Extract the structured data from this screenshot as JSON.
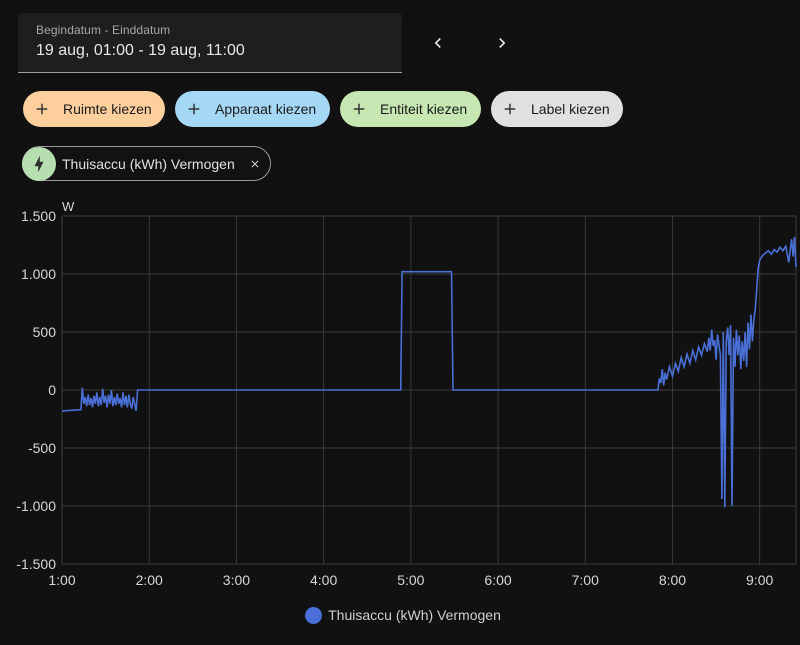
{
  "date_picker": {
    "label": "Begindatum - Einddatum",
    "value": "19 aug, 01:00 - 19 aug, 11:00"
  },
  "nav": {
    "prev_icon": "chevron-left-icon",
    "next_icon": "chevron-right-icon"
  },
  "target_chips": [
    {
      "label": "Ruimte kiezen",
      "color": "#fccf9d"
    },
    {
      "label": "Apparaat kiezen",
      "color": "#a4d8f4"
    },
    {
      "label": "Entiteit kiezen",
      "color": "#c6e6b2"
    },
    {
      "label": "Label kiezen",
      "color": "#e0e0e0"
    }
  ],
  "selected_entity": {
    "label": "Thuisaccu (kWh) Vermogen",
    "icon": "lightning-bolt-icon"
  },
  "chart_data": {
    "type": "line",
    "ylabel": "W",
    "ylim": [
      -1500,
      1500
    ],
    "yticks": [
      "1.500",
      "1.000",
      "500",
      "0",
      "-500",
      "-1.000",
      "-1.500"
    ],
    "ytick_values": [
      1500,
      1000,
      500,
      0,
      -500,
      -1000,
      -1500
    ],
    "xlim": [
      "01:00",
      "09:25"
    ],
    "xticks": [
      "1:00",
      "2:00",
      "3:00",
      "4:00",
      "5:00",
      "6:00",
      "7:00",
      "8:00",
      "9:00"
    ],
    "grid": true,
    "legend_position": "bottom",
    "series": [
      {
        "name": "Thuisaccu (kWh) Vermogen",
        "color": "#4a6fd6",
        "points": [
          [
            "01:00",
            -180
          ],
          [
            "01:13",
            -170
          ],
          [
            "01:14",
            20
          ],
          [
            "01:15",
            -120
          ],
          [
            "01:16",
            -60
          ],
          [
            "01:17",
            -140
          ],
          [
            "01:18",
            -40
          ],
          [
            "01:19",
            -130
          ],
          [
            "01:20",
            -70
          ],
          [
            "01:21",
            -150
          ],
          [
            "01:22",
            -50
          ],
          [
            "01:23",
            -120
          ],
          [
            "01:24",
            -20
          ],
          [
            "01:25",
            -140
          ],
          [
            "01:26",
            -60
          ],
          [
            "01:27",
            -130
          ],
          [
            "01:28",
            10
          ],
          [
            "01:29",
            -110
          ],
          [
            "01:30",
            -50
          ],
          [
            "01:31",
            -150
          ],
          [
            "01:32",
            -40
          ],
          [
            "01:33",
            -120
          ],
          [
            "01:34",
            0
          ],
          [
            "01:35",
            -140
          ],
          [
            "01:36",
            -60
          ],
          [
            "01:37",
            -130
          ],
          [
            "01:38",
            -30
          ],
          [
            "01:39",
            -120
          ],
          [
            "01:40",
            -70
          ],
          [
            "01:41",
            -150
          ],
          [
            "01:42",
            -20
          ],
          [
            "01:43",
            -130
          ],
          [
            "01:44",
            -50
          ],
          [
            "01:45",
            -150
          ],
          [
            "01:46",
            -40
          ],
          [
            "01:47",
            -120
          ],
          [
            "01:48",
            -160
          ],
          [
            "01:49",
            -60
          ],
          [
            "01:51",
            -180
          ],
          [
            "01:52",
            0
          ],
          [
            "04:53",
            0
          ],
          [
            "04:54",
            1020
          ],
          [
            "05:28",
            1020
          ],
          [
            "05:29",
            0
          ],
          [
            "07:50",
            0
          ],
          [
            "07:51",
            100
          ],
          [
            "07:52",
            60
          ],
          [
            "07:53",
            180
          ],
          [
            "07:54",
            40
          ],
          [
            "07:55",
            150
          ],
          [
            "07:56",
            90
          ],
          [
            "07:58",
            200
          ],
          [
            "08:00",
            120
          ],
          [
            "08:02",
            230
          ],
          [
            "08:04",
            160
          ],
          [
            "08:06",
            280
          ],
          [
            "08:08",
            200
          ],
          [
            "08:10",
            310
          ],
          [
            "08:12",
            230
          ],
          [
            "08:14",
            340
          ],
          [
            "08:16",
            260
          ],
          [
            "08:18",
            370
          ],
          [
            "08:20",
            300
          ],
          [
            "08:22",
            400
          ],
          [
            "08:24",
            330
          ],
          [
            "08:25",
            450
          ],
          [
            "08:26",
            340
          ],
          [
            "08:27",
            520
          ],
          [
            "08:28",
            380
          ],
          [
            "08:29",
            430
          ],
          [
            "08:30",
            260
          ],
          [
            "08:31",
            480
          ],
          [
            "08:33",
            300
          ],
          [
            "08:34",
            -940
          ],
          [
            "08:35",
            500
          ],
          [
            "08:36",
            -1010
          ],
          [
            "08:37",
            420
          ],
          [
            "08:38",
            540
          ],
          [
            "08:39",
            300
          ],
          [
            "08:40",
            560
          ],
          [
            "08:41",
            -1000
          ],
          [
            "08:42",
            450
          ],
          [
            "08:43",
            200
          ],
          [
            "08:44",
            520
          ],
          [
            "08:45",
            300
          ],
          [
            "08:46",
            470
          ],
          [
            "08:47",
            180
          ],
          [
            "08:48",
            420
          ],
          [
            "08:49",
            250
          ],
          [
            "08:50",
            500
          ],
          [
            "08:51",
            200
          ],
          [
            "08:52",
            580
          ],
          [
            "08:53",
            350
          ],
          [
            "08:54",
            650
          ],
          [
            "08:55",
            420
          ],
          [
            "08:56",
            600
          ],
          [
            "08:57",
            700
          ],
          [
            "08:58",
            880
          ],
          [
            "08:59",
            1050
          ],
          [
            "09:00",
            1120
          ],
          [
            "09:02",
            1160
          ],
          [
            "09:04",
            1180
          ],
          [
            "09:06",
            1200
          ],
          [
            "09:08",
            1170
          ],
          [
            "09:10",
            1210
          ],
          [
            "09:12",
            1190
          ],
          [
            "09:14",
            1230
          ],
          [
            "09:16",
            1200
          ],
          [
            "09:18",
            1240
          ],
          [
            "09:20",
            1100
          ],
          [
            "09:22",
            1300
          ],
          [
            "09:23",
            1150
          ],
          [
            "09:24",
            1320
          ],
          [
            "09:25",
            1060
          ]
        ]
      }
    ]
  }
}
